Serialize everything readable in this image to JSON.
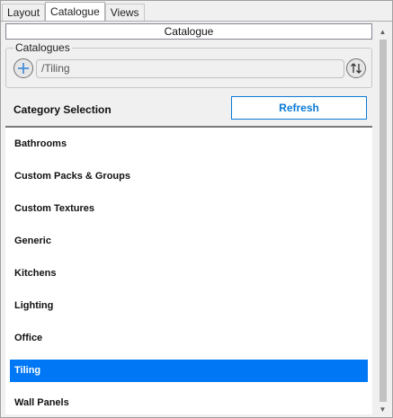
{
  "tabs": [
    {
      "label": "Layout",
      "active": false
    },
    {
      "label": "Catalogue",
      "active": true
    },
    {
      "label": "Views",
      "active": false
    }
  ],
  "panel_title": "Catalogue",
  "catalogues": {
    "legend": "Catalogues",
    "path_value": "/Tiling",
    "add_icon": "add-circle-icon",
    "sort_icon": "sort-arrows-icon"
  },
  "category": {
    "label": "Category Selection",
    "refresh_label": "Refresh",
    "items": [
      {
        "label": "Bathrooms",
        "selected": false
      },
      {
        "label": "Custom Packs & Groups",
        "selected": false
      },
      {
        "label": "Custom Textures",
        "selected": false
      },
      {
        "label": "Generic",
        "selected": false
      },
      {
        "label": "Kitchens",
        "selected": false
      },
      {
        "label": "Lighting",
        "selected": false
      },
      {
        "label": "Office",
        "selected": false
      },
      {
        "label": "Tiling",
        "selected": true
      },
      {
        "label": "Wall Panels",
        "selected": false
      }
    ]
  },
  "colors": {
    "accent": "#0078f5",
    "refresh_text": "#0b7ad6"
  }
}
